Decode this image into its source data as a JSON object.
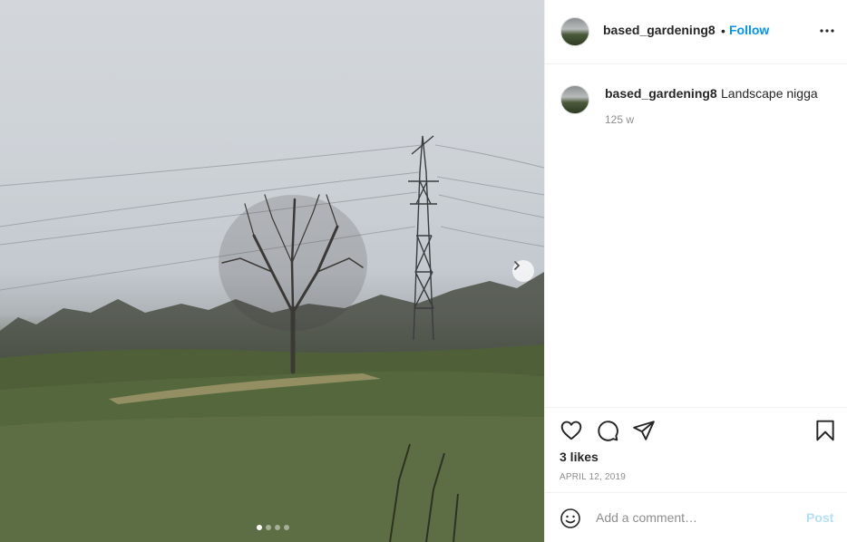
{
  "post": {
    "image_alt": "Landscape with a bare tree and an electricity pylon in a grassy field",
    "carousel": {
      "slide_count": 4,
      "active_index": 0
    }
  },
  "header": {
    "username": "based_gardening8",
    "separator": "•",
    "follow_label": "Follow"
  },
  "caption": {
    "username": "based_gardening8",
    "text": "Landscape nigga",
    "time_ago": "125 w"
  },
  "actions": {
    "likes": "3 likes",
    "date": "APRIL 12, 2019"
  },
  "comment": {
    "placeholder": "Add a comment…",
    "post_label": "Post"
  },
  "icons": {
    "next": "chevron-right-icon",
    "more": "more-horizontal-icon",
    "like": "heart-icon",
    "comment": "comment-bubble-icon",
    "share": "paper-plane-icon",
    "save": "bookmark-icon",
    "emoji": "smiley-icon"
  },
  "colors": {
    "accent": "#0095f6",
    "post_disabled": "#b2dffc",
    "muted": "#8e8e8e",
    "text": "#262626",
    "border": "#efefef"
  }
}
